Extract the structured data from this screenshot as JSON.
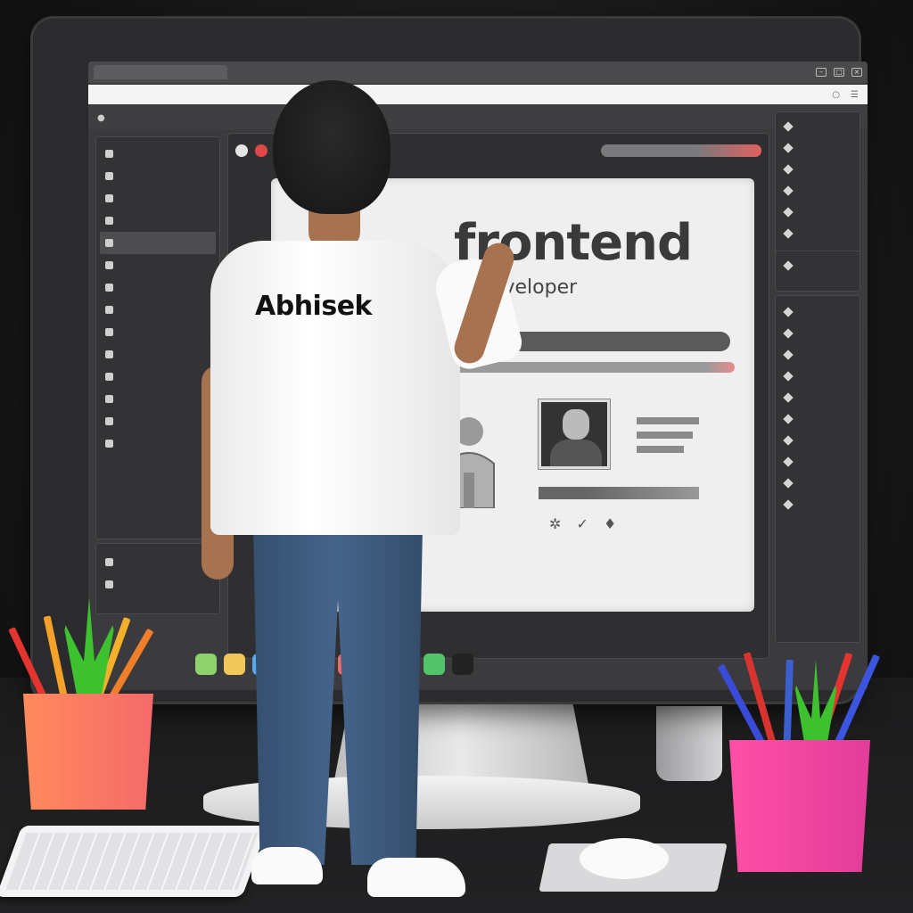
{
  "scene": {
    "shirt_text": "Abhisek"
  },
  "screen": {
    "tab_label": "",
    "sidebar_items": [
      "",
      "",
      "",
      "",
      "",
      "",
      "",
      "",
      "",
      "",
      "",
      "",
      "",
      ""
    ],
    "bottom_items": [
      "",
      ""
    ],
    "right_items": [
      "",
      "",
      "",
      "",
      "",
      ""
    ],
    "right_items_2": [
      "",
      ""
    ],
    "right_items_3": [
      "",
      "",
      "",
      "",
      "",
      "",
      "",
      "",
      "",
      ""
    ],
    "canvas": {
      "title": "frontend",
      "subtitle": "Developer"
    }
  },
  "colors": {
    "accent_red": "#e04848",
    "shirt": "#ffffff",
    "jeans": "#45648a",
    "cup_left": "#ff8a5c",
    "cup_right": "#ff4fa6",
    "plant": "#3ec12e"
  },
  "icons": [
    "search-icon",
    "close-icon",
    "user-placeholder-icon",
    "photo-icon"
  ]
}
